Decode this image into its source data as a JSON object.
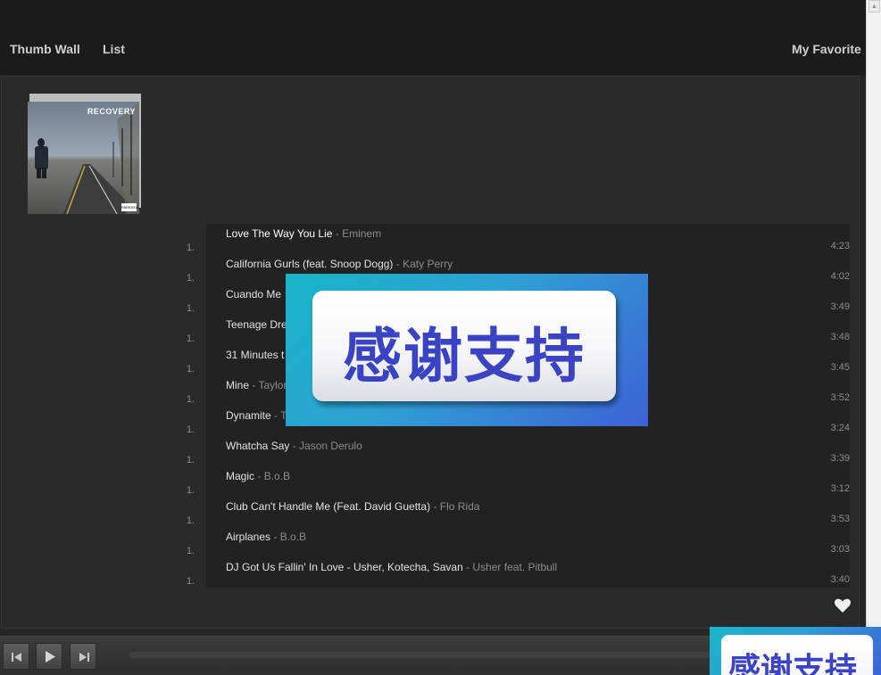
{
  "nav": {
    "thumb_wall": "Thumb Wall",
    "list": "List",
    "favorites": "My Favorites"
  },
  "album": {
    "logo": "RECOVERY",
    "advisory": "PARENTAL ADVISORY"
  },
  "tracks": [
    {
      "num": "1.",
      "title": "Love The Way You Lie",
      "sep": " - ",
      "artist": "Eminem",
      "duration": "4:23"
    },
    {
      "num": "1.",
      "title": "California Gurls (feat. Snoop Dogg)",
      "sep": " - ",
      "artist": "Katy Perry",
      "duration": "4:02"
    },
    {
      "num": "1.",
      "title": "Cuando Me",
      "sep": "",
      "artist": "",
      "duration": "3:49"
    },
    {
      "num": "1.",
      "title": "Teenage Dre",
      "sep": "",
      "artist": "",
      "duration": "3:48"
    },
    {
      "num": "1.",
      "title": "31 Minutes t",
      "sep": "",
      "artist": "",
      "duration": "3:45"
    },
    {
      "num": "1.",
      "title": "Mine",
      "sep": " - ",
      "artist": "Taylor",
      "duration": "3:52"
    },
    {
      "num": "1.",
      "title": "Dynamite",
      "sep": " - ",
      "artist": "T",
      "duration": "3:24"
    },
    {
      "num": "1.",
      "title": "Whatcha Say",
      "sep": " - ",
      "artist": "Jason Derulo",
      "duration": "3:39"
    },
    {
      "num": "1.",
      "title": "Magic",
      "sep": " - ",
      "artist": "B.o.B",
      "duration": "3:12"
    },
    {
      "num": "1.",
      "title": "Club Can't Handle Me (Feat. David Guetta)",
      "sep": " - ",
      "artist": "Flo Rida",
      "duration": "3:53"
    },
    {
      "num": "1.",
      "title": "Airplanes",
      "sep": " - ",
      "artist": "B.o.B",
      "duration": "3:03"
    },
    {
      "num": "1.",
      "title": "DJ Got Us Fallin' In Love - Usher, Kotecha, Savan",
      "sep": " - ",
      "artist": "Usher feat. Pitbull",
      "duration": "3:40"
    }
  ],
  "ad": {
    "text": "感谢支持"
  },
  "player": {
    "prev_icon": "previous-track-icon",
    "play_icon": "play-icon",
    "next_icon": "next-track-icon",
    "favorite_icon": "heart-icon"
  },
  "colors": {
    "background": "#262626",
    "topbar": "#1b1b1b",
    "tracklist_bg": "#222222",
    "title_text": "#e2e2e2",
    "artist_text": "#8c8c8c",
    "ad_text": "#3a43c3"
  }
}
